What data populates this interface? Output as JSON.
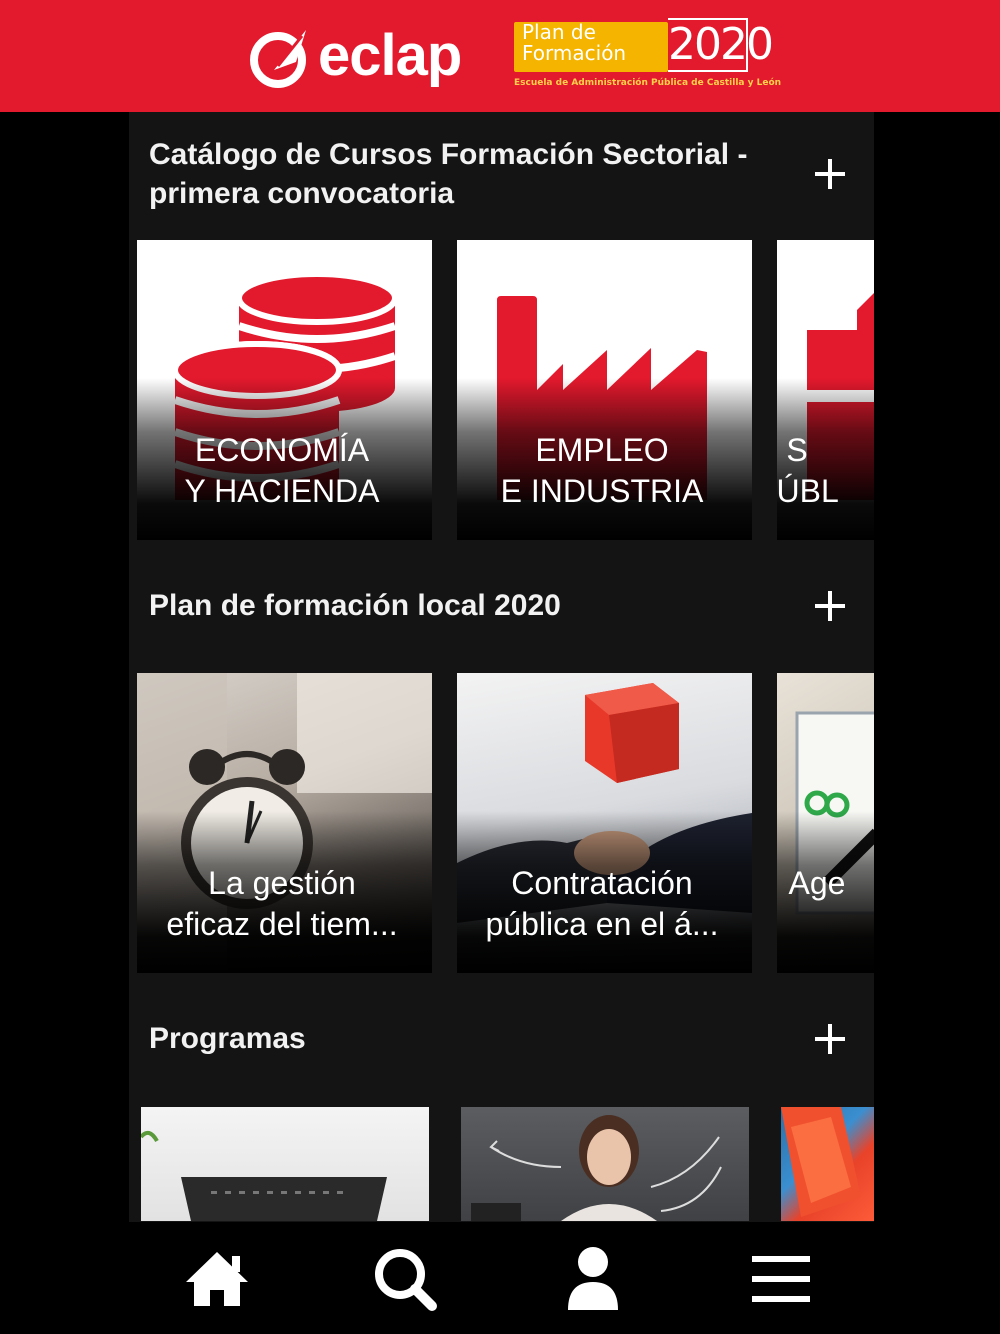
{
  "header": {
    "brand": "eclap",
    "plan_line1": "Plan de",
    "plan_line2": "Formación",
    "plan_year": "2020",
    "plan_subtitle": "Escuela de Administración Pública de Castilla y León",
    "background_color": "#e3192d"
  },
  "sections": [
    {
      "title": "Catálogo de Cursos Formación Sectorial - primera convocatoria",
      "cards": [
        {
          "label": "ECONOMÍA\nY HACIENDA",
          "icon": "coins-icon"
        },
        {
          "label": "EMPLEO\nE INDUSTRIA",
          "icon": "factory-icon"
        },
        {
          "label": "S\nPÚBL",
          "icon": "briefcase-icon"
        }
      ]
    },
    {
      "title": "Plan de formación local 2020",
      "cards": [
        {
          "label": "La gestión\neficaz del tiem...",
          "icon": "alarm-clock-photo"
        },
        {
          "label": "Contratación\npública en el á...",
          "icon": "handshake-photo"
        },
        {
          "label": "Age",
          "icon": "notebook-photo"
        }
      ]
    },
    {
      "title": "Programas",
      "cards": [
        {
          "label": "",
          "icon": "laptop-photo"
        },
        {
          "label": "",
          "icon": "woman-photo"
        },
        {
          "label": "",
          "icon": "abstract-photo"
        }
      ]
    }
  ],
  "navbar": {
    "items": [
      "home-icon",
      "search-icon",
      "user-icon",
      "menu-icon"
    ]
  },
  "colors": {
    "accent": "#e3192d",
    "content_bg": "#141414",
    "page_bg": "#000000"
  }
}
